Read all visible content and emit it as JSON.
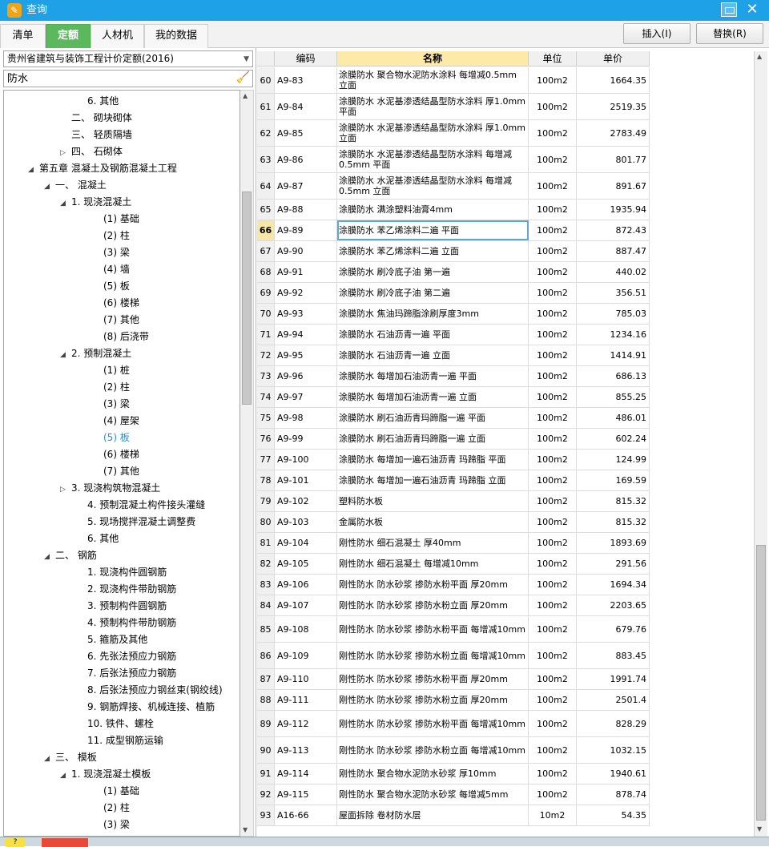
{
  "window": {
    "title": "查询"
  },
  "tabs": [
    "清单",
    "定额",
    "人材机",
    "我的数据"
  ],
  "actions": {
    "insert": "插入(I)",
    "replace": "替换(R)"
  },
  "dataset": "贵州省建筑与装饰工程计价定额(2016)",
  "search": "防水",
  "tree": [
    {
      "label": "6. 其他",
      "d": 4,
      "t": ""
    },
    {
      "label": "二、 砌块砌体",
      "d": 3,
      "t": ""
    },
    {
      "label": "三、 轻质隔墙",
      "d": 3,
      "t": ""
    },
    {
      "label": "四、 石砌体",
      "d": 3,
      "t": "▷"
    },
    {
      "label": "第五章 混凝土及钢筋混凝土工程",
      "d": 1,
      "t": "◢"
    },
    {
      "label": "一、 混凝土",
      "d": 2,
      "t": "◢"
    },
    {
      "label": "1. 现浇混凝土",
      "d": 3,
      "t": "◢"
    },
    {
      "label": "(1) 基础",
      "d": 5,
      "t": ""
    },
    {
      "label": "(2) 柱",
      "d": 5,
      "t": ""
    },
    {
      "label": "(3) 梁",
      "d": 5,
      "t": ""
    },
    {
      "label": "(4) 墙",
      "d": 5,
      "t": ""
    },
    {
      "label": "(5) 板",
      "d": 5,
      "t": ""
    },
    {
      "label": "(6) 楼梯",
      "d": 5,
      "t": ""
    },
    {
      "label": "(7) 其他",
      "d": 5,
      "t": ""
    },
    {
      "label": "(8) 后浇带",
      "d": 5,
      "t": ""
    },
    {
      "label": "2. 预制混凝土",
      "d": 3,
      "t": "◢"
    },
    {
      "label": "(1) 桩",
      "d": 5,
      "t": ""
    },
    {
      "label": "(2) 柱",
      "d": 5,
      "t": ""
    },
    {
      "label": "(3) 梁",
      "d": 5,
      "t": ""
    },
    {
      "label": "(4) 屋架",
      "d": 5,
      "t": ""
    },
    {
      "label": "(5) 板",
      "d": 5,
      "t": "",
      "sel": true
    },
    {
      "label": "(6) 楼梯",
      "d": 5,
      "t": ""
    },
    {
      "label": "(7) 其他",
      "d": 5,
      "t": ""
    },
    {
      "label": "3. 现浇构筑物混凝土",
      "d": 3,
      "t": "▷"
    },
    {
      "label": "4. 预制混凝土构件接头灌缝",
      "d": 4,
      "t": ""
    },
    {
      "label": "5. 现场搅拌混凝土调整费",
      "d": 4,
      "t": ""
    },
    {
      "label": "6. 其他",
      "d": 4,
      "t": ""
    },
    {
      "label": "二、 钢筋",
      "d": 2,
      "t": "◢"
    },
    {
      "label": "1. 现浇构件圆钢筋",
      "d": 4,
      "t": ""
    },
    {
      "label": "2. 现浇构件带肋钢筋",
      "d": 4,
      "t": ""
    },
    {
      "label": "3. 预制构件圆钢筋",
      "d": 4,
      "t": ""
    },
    {
      "label": "4. 预制构件带肋钢筋",
      "d": 4,
      "t": ""
    },
    {
      "label": "5. 箍筋及其他",
      "d": 4,
      "t": ""
    },
    {
      "label": "6. 先张法预应力钢筋",
      "d": 4,
      "t": ""
    },
    {
      "label": "7. 后张法预应力钢筋",
      "d": 4,
      "t": ""
    },
    {
      "label": "8. 后张法预应力钢丝束(钢绞线)",
      "d": 4,
      "t": ""
    },
    {
      "label": "9. 钢筋焊接、机械连接、植筋",
      "d": 4,
      "t": ""
    },
    {
      "label": "10. 铁件、螺栓",
      "d": 4,
      "t": ""
    },
    {
      "label": "11. 成型钢筋运输",
      "d": 4,
      "t": ""
    },
    {
      "label": "三、 模板",
      "d": 2,
      "t": "◢"
    },
    {
      "label": "1. 现浇混凝土模板",
      "d": 3,
      "t": "◢"
    },
    {
      "label": "(1) 基础",
      "d": 5,
      "t": ""
    },
    {
      "label": "(2) 柱",
      "d": 5,
      "t": ""
    },
    {
      "label": "(3) 梁",
      "d": 5,
      "t": ""
    }
  ],
  "grid": {
    "headers": [
      "编码",
      "名称",
      "单位",
      "单价"
    ],
    "current": "66",
    "rows": [
      [
        "60",
        "A9-83",
        "涂膜防水 聚合物水泥防水涂料 每增减0.5mm 立面",
        "100m2",
        "1664.35"
      ],
      [
        "61",
        "A9-84",
        "涂膜防水 水泥基渗透结晶型防水涂料 厚1.0mm 平面",
        "100m2",
        "2519.35"
      ],
      [
        "62",
        "A9-85",
        "涂膜防水 水泥基渗透结晶型防水涂料 厚1.0mm 立面",
        "100m2",
        "2783.49"
      ],
      [
        "63",
        "A9-86",
        "涂膜防水 水泥基渗透结晶型防水涂料 每增减0.5mm 平面",
        "100m2",
        "801.77"
      ],
      [
        "64",
        "A9-87",
        "涂膜防水 水泥基渗透结晶型防水涂料 每增减0.5mm 立面",
        "100m2",
        "891.67"
      ],
      [
        "65",
        "A9-88",
        "涂膜防水 满涂塑料油膏4mm",
        "100m2",
        "1935.94"
      ],
      [
        "66",
        "A9-89",
        "涂膜防水 苯乙烯涂料二遍 平面",
        "100m2",
        "872.43"
      ],
      [
        "67",
        "A9-90",
        "涂膜防水 苯乙烯涂料二遍 立面",
        "100m2",
        "887.47"
      ],
      [
        "68",
        "A9-91",
        "涂膜防水 刷冷底子油 第一遍",
        "100m2",
        "440.02"
      ],
      [
        "69",
        "A9-92",
        "涂膜防水 刷冷底子油 第二遍",
        "100m2",
        "356.51"
      ],
      [
        "70",
        "A9-93",
        "涂膜防水 焦油玛蹄脂涂刷厚度3mm",
        "100m2",
        "785.03"
      ],
      [
        "71",
        "A9-94",
        "涂膜防水 石油沥青一遍 平面",
        "100m2",
        "1234.16"
      ],
      [
        "72",
        "A9-95",
        "涂膜防水 石油沥青一遍 立面",
        "100m2",
        "1414.91"
      ],
      [
        "73",
        "A9-96",
        "涂膜防水 每增加石油沥青一遍 平面",
        "100m2",
        "686.13"
      ],
      [
        "74",
        "A9-97",
        "涂膜防水 每增加石油沥青一遍 立面",
        "100m2",
        "855.25"
      ],
      [
        "75",
        "A9-98",
        "涂膜防水 刷石油沥青玛蹄脂一遍 平面",
        "100m2",
        "486.01"
      ],
      [
        "76",
        "A9-99",
        "涂膜防水 刷石油沥青玛蹄脂一遍 立面",
        "100m2",
        "602.24"
      ],
      [
        "77",
        "A9-100",
        "涂膜防水 每增加一遍石油沥青 玛蹄脂 平面",
        "100m2",
        "124.99"
      ],
      [
        "78",
        "A9-101",
        "涂膜防水 每增加一遍石油沥青 玛蹄脂 立面",
        "100m2",
        "169.59"
      ],
      [
        "79",
        "A9-102",
        "塑料防水板",
        "100m2",
        "815.32"
      ],
      [
        "80",
        "A9-103",
        "金属防水板",
        "100m2",
        "815.32"
      ],
      [
        "81",
        "A9-104",
        "刚性防水 细石混凝土 厚40mm",
        "100m2",
        "1893.69"
      ],
      [
        "82",
        "A9-105",
        "刚性防水 细石混凝土 每增减10mm",
        "100m2",
        "291.56"
      ],
      [
        "83",
        "A9-106",
        "刚性防水 防水砂浆 掺防水粉平面 厚20mm",
        "100m2",
        "1694.34"
      ],
      [
        "84",
        "A9-107",
        "刚性防水 防水砂浆 掺防水粉立面 厚20mm",
        "100m2",
        "2203.65"
      ],
      [
        "85",
        "A9-108",
        "刚性防水 防水砂浆 掺防水粉平面 每增减10mm",
        "100m2",
        "679.76"
      ],
      [
        "86",
        "A9-109",
        "刚性防水 防水砂浆 掺防水粉立面 每增减10mm",
        "100m2",
        "883.45"
      ],
      [
        "87",
        "A9-110",
        "刚性防水 防水砂浆 掺防水粉平面 厚20mm",
        "100m2",
        "1991.74"
      ],
      [
        "88",
        "A9-111",
        "刚性防水 防水砂浆 掺防水粉立面 厚20mm",
        "100m2",
        "2501.4"
      ],
      [
        "89",
        "A9-112",
        "刚性防水 防水砂浆 掺防水粉平面 每增减10mm",
        "100m2",
        "828.29"
      ],
      [
        "90",
        "A9-113",
        "刚性防水 防水砂浆 掺防水粉立面 每增减10mm",
        "100m2",
        "1032.15"
      ],
      [
        "91",
        "A9-114",
        "刚性防水 聚合物水泥防水砂浆 厚10mm",
        "100m2",
        "1940.61"
      ],
      [
        "92",
        "A9-115",
        "刚性防水 聚合物水泥防水砂浆 每增减5mm",
        "100m2",
        "878.74"
      ],
      [
        "93",
        "A16-66",
        "屋面拆除 卷材防水层",
        "10m2",
        "54.35"
      ]
    ]
  }
}
